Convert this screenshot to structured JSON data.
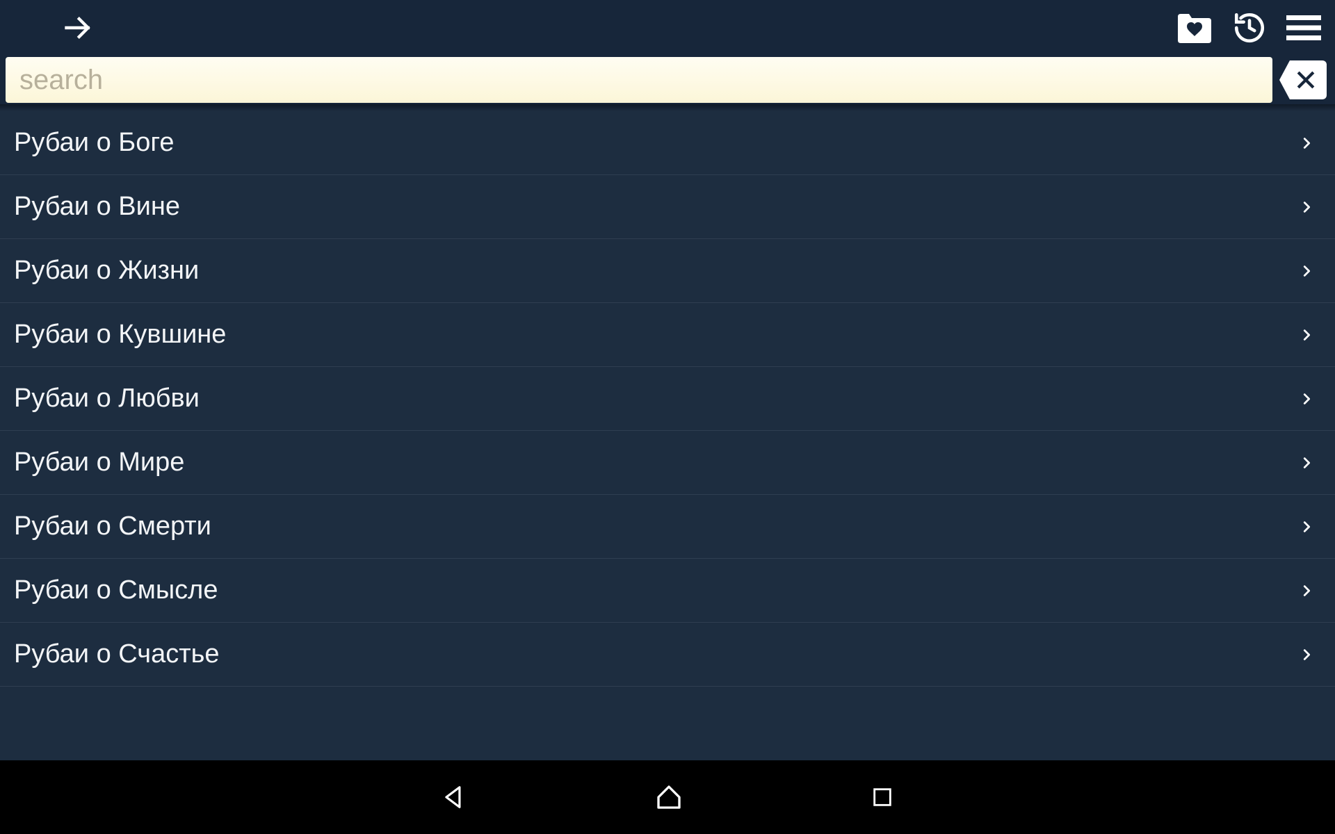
{
  "search": {
    "placeholder": "search",
    "value": ""
  },
  "list_items": [
    {
      "label": "Рубаи о Боге"
    },
    {
      "label": "Рубаи о Вине"
    },
    {
      "label": "Рубаи о Жизни"
    },
    {
      "label": "Рубаи о Кувшине"
    },
    {
      "label": "Рубаи о Любви"
    },
    {
      "label": "Рубаи о Мире"
    },
    {
      "label": "Рубаи о Смерти"
    },
    {
      "label": "Рубаи о Смысле"
    },
    {
      "label": "Рубаи о Счастье"
    }
  ]
}
